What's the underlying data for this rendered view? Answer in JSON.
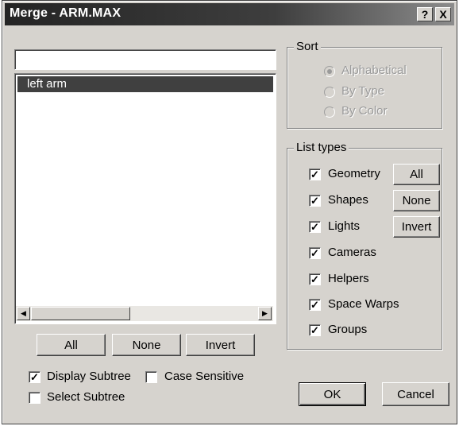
{
  "window": {
    "title": "Merge - ARM.MAX",
    "help_label": "?",
    "close_label": "X"
  },
  "filter": {
    "value": "",
    "placeholder": ""
  },
  "object_list": {
    "items": [
      "left arm"
    ],
    "selected_index": 0
  },
  "scroll": {
    "left_arrow": "◀",
    "right_arrow": "▶"
  },
  "list_buttons": {
    "all": "All",
    "none": "None",
    "invert": "Invert"
  },
  "options": {
    "display_subtree": {
      "label": "Display Subtree",
      "checked": true
    },
    "case_sensitive": {
      "label": "Case Sensitive",
      "checked": false
    },
    "select_subtree": {
      "label": "Select Subtree",
      "checked": false
    }
  },
  "sort": {
    "title": "Sort",
    "options": [
      {
        "label": "Alphabetical",
        "selected": true
      },
      {
        "label": "By Type",
        "selected": false
      },
      {
        "label": "By Color",
        "selected": false
      }
    ]
  },
  "list_types": {
    "title": "List types",
    "items": [
      {
        "label": "Geometry",
        "checked": true
      },
      {
        "label": "Shapes",
        "checked": true
      },
      {
        "label": "Lights",
        "checked": true
      },
      {
        "label": "Cameras",
        "checked": true
      },
      {
        "label": "Helpers",
        "checked": true
      },
      {
        "label": "Space Warps",
        "checked": true
      },
      {
        "label": "Groups",
        "checked": true
      }
    ],
    "buttons": {
      "all": "All",
      "none": "None",
      "invert": "Invert"
    }
  },
  "dialog_buttons": {
    "ok": "OK",
    "cancel": "Cancel"
  },
  "check_glyph": "✓"
}
